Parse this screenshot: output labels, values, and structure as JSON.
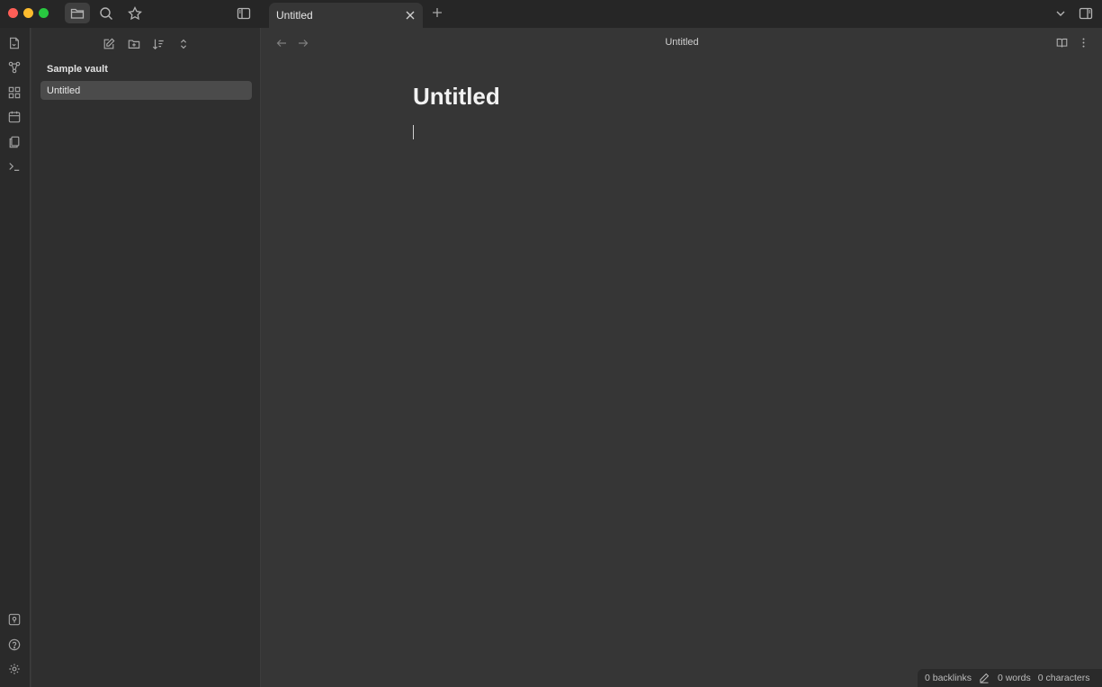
{
  "app": {
    "tab_title": "Untitled",
    "view_title": "Untitled"
  },
  "sidebar": {
    "vault_name": "Sample vault",
    "files": [
      {
        "name": "Untitled",
        "selected": true
      }
    ]
  },
  "editor": {
    "note_title": "Untitled"
  },
  "statusbar": {
    "backlinks": "0 backlinks",
    "words": "0 words",
    "characters": "0 characters"
  },
  "colors": {
    "titlebar": "#262626",
    "ribbon": "#2a2a2a",
    "sidebar": "#2f2f2f",
    "editor": "#363636",
    "selected_file": "#4b4b4b"
  },
  "icons": {
    "titlebar": [
      "folder-icon",
      "search-icon",
      "star-icon",
      "sidebar-toggle-icon"
    ],
    "ribbon_top": [
      "open-quick-switcher-icon",
      "graph-view-icon",
      "canvas-icon",
      "daily-note-icon",
      "templates-icon",
      "command-palette-icon"
    ],
    "ribbon_bottom": [
      "vault-switcher-icon",
      "help-icon",
      "settings-icon"
    ],
    "sidebar_tools": [
      "new-note-icon",
      "new-folder-icon",
      "sort-icon",
      "collapse-icon"
    ],
    "view_actions": [
      "reading-view-icon",
      "more-options-icon"
    ]
  }
}
